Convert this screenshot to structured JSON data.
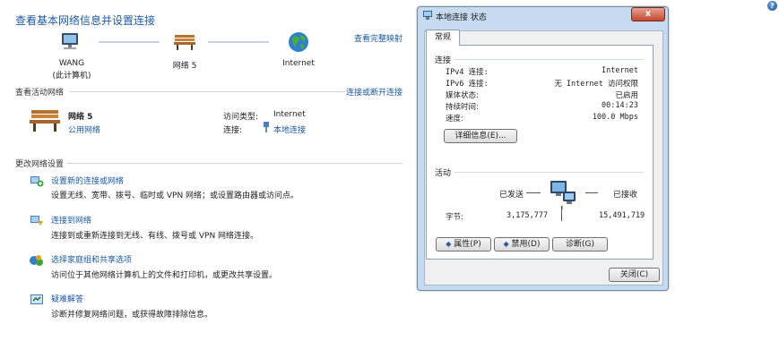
{
  "left": {
    "title": "查看基本网络信息并设置连接",
    "view_full_map": "查看完整映射",
    "map": {
      "computer_name": "WANG",
      "computer_sub": "(此计算机)",
      "network_name": "网络 5",
      "internet": "Internet"
    },
    "active_header": "查看活动网络",
    "connect_disconnect": "连接或断开连接",
    "active": {
      "name": "网络 5",
      "type": "公用网络",
      "access_label": "访问类型:",
      "access_value": "Internet",
      "conn_label": "连接:",
      "conn_value": "本地连接"
    },
    "change_header": "更改网络设置",
    "tasks": [
      {
        "title": "设置新的连接或网络",
        "desc": "设置无线、宽带、拨号、临时或 VPN 网络；或设置路由器或访问点。",
        "icon": "new-connection-icon"
      },
      {
        "title": "连接到网络",
        "desc": "连接到或重新连接到无线、有线、拨号或 VPN 网络连接。",
        "icon": "connect-network-icon"
      },
      {
        "title": "选择家庭组和共享选项",
        "desc": "访问位于其他网络计算机上的文件和打印机，或更改共享设置。",
        "icon": "homegroup-icon"
      },
      {
        "title": "疑难解答",
        "desc": "诊断并修复网络问题，或获得故障排除信息。",
        "icon": "troubleshoot-icon"
      }
    ]
  },
  "dialog": {
    "title": "本地连接 状态",
    "tab": "常规",
    "connection_header": "连接",
    "rows": [
      {
        "label": "IPv4 连接:",
        "value": "Internet"
      },
      {
        "label": "IPv6 连接:",
        "value": "无 Internet 访问权限"
      },
      {
        "label": "媒体状态:",
        "value": "已启用"
      },
      {
        "label": "持续时间:",
        "value": "00:14:23"
      },
      {
        "label": "速度:",
        "value": "100.0 Mbps"
      }
    ],
    "details_button": "详细信息(E)...",
    "activity_header": "活动",
    "sent_label": "已发送",
    "received_label": "已接收",
    "bytes_label": "字节:",
    "bytes_sent": "3,175,777",
    "bytes_received": "15,491,719",
    "properties_button": "属性(P)",
    "disable_button": "禁用(D)",
    "diagnose_button": "诊断(G)",
    "close_button": "关闭(C)",
    "close_x": "x"
  },
  "help_icon": "?"
}
